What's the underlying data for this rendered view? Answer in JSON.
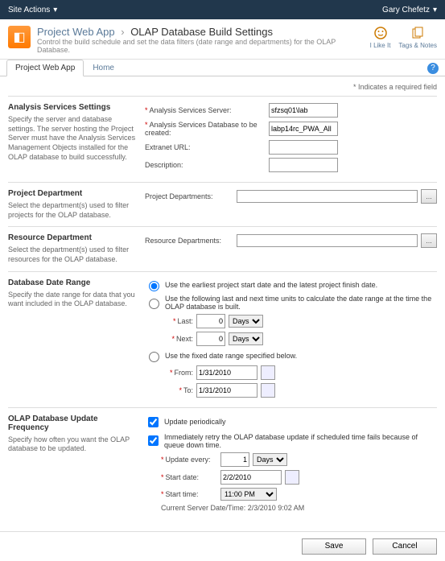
{
  "ribbon": {
    "site_actions": "Site Actions",
    "user": "Gary Chefetz"
  },
  "header": {
    "crumb_root": "Project Web App",
    "crumb_leaf": "OLAP Database Build Settings",
    "subtitle": "Control the build schedule and set the data filters (date range and departments) for the OLAP Database.",
    "like": "I Like It",
    "tags": "Tags & Notes"
  },
  "tabs": {
    "t1": "Project Web App",
    "t2": "Home"
  },
  "req_note": "* Indicates a required field",
  "s1": {
    "title": "Analysis Services Settings",
    "desc": "Specify the server and database settings. The server hosting the Project Server must have the Analysis Services Management Objects installed for the OLAP database to build successfully.",
    "l_server": "Analysis Services Server:",
    "v_server": "sfzsq01\\lab",
    "l_db": "Analysis Services Database to be created:",
    "v_db": "labp14rc_PWA_All",
    "l_ext": "Extranet URL:",
    "l_desc": "Description:"
  },
  "s2": {
    "title": "Project Department",
    "desc": "Select the department(s) used to filter projects for the OLAP database.",
    "l": "Project Departments:"
  },
  "s3": {
    "title": "Resource Department",
    "desc": "Select the department(s) used to filter resources for the OLAP database.",
    "l": "Resource Departments:"
  },
  "s4": {
    "title": "Database Date Range",
    "desc": "Specify the date range for data that you want included in the OLAP database.",
    "r1": "Use the earliest project start date and the latest project finish date.",
    "r2": "Use the following last and next time units to calculate the date range at the time the OLAP database is built.",
    "l_last": "Last:",
    "v_last": "0",
    "u_last": "Days",
    "l_next": "Next:",
    "v_next": "0",
    "u_next": "Days",
    "r3": "Use the fixed date range specified below.",
    "l_from": "From:",
    "v_from": "1/31/2010",
    "l_to": "To:",
    "v_to": "1/31/2010"
  },
  "s5": {
    "title": "OLAP Database Update Frequency",
    "desc": "Specify how often you want the OLAP database to be updated.",
    "c1": "Update periodically",
    "c2": "Immediately retry the OLAP database update if scheduled time fails because of queue down time.",
    "l_every": "Update every:",
    "v_every": "1",
    "u_every": "Days",
    "l_start": "Start date:",
    "v_start": "2/2/2010",
    "l_time": "Start time:",
    "v_time": "11:00 PM",
    "note": "Current Server Date/Time: 2/3/2010 9:02 AM"
  },
  "btns": {
    "save": "Save",
    "cancel": "Cancel"
  }
}
